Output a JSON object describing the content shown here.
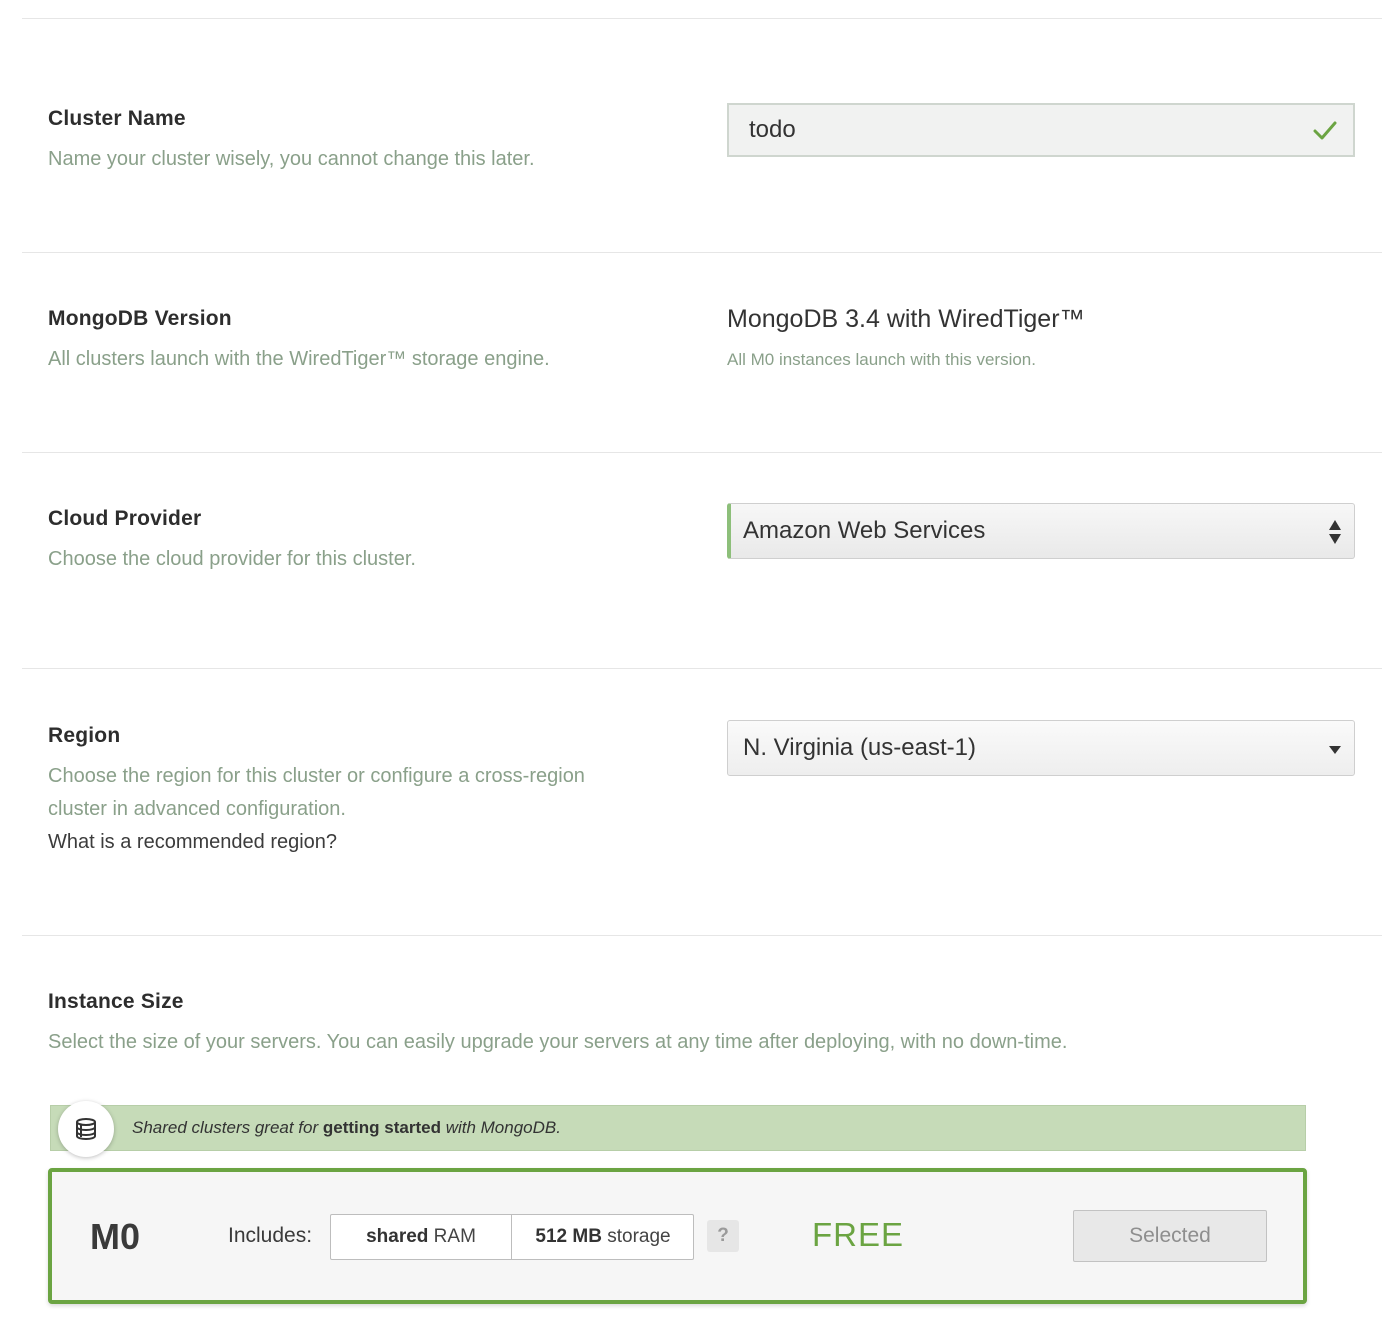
{
  "cluster_name": {
    "label": "Cluster Name",
    "description": "Name your cluster wisely, you cannot change this later.",
    "value": "todo",
    "status_icon": "check-icon",
    "accent_color": "#6ba442"
  },
  "mongodb_version": {
    "label": "MongoDB Version",
    "description": "All clusters launch with the WiredTiger™ storage engine.",
    "value": "MongoDB 3.4 with WiredTiger™",
    "note": "All M0 instances launch with this version."
  },
  "cloud_provider": {
    "label": "Cloud Provider",
    "description": "Choose the cloud provider for this cluster.",
    "selected": "Amazon Web Services",
    "icon": "updown-icon"
  },
  "region": {
    "label": "Region",
    "description_line1": "Choose the region for this cluster or configure a cross-region",
    "description_line2": "cluster in advanced configuration.",
    "help_link": "What is a recommended region?",
    "selected": "N. Virginia (us-east-1)",
    "icon": "caret-down-icon"
  },
  "instance_size": {
    "label": "Instance Size",
    "description": "Select the size of your servers. You can easily upgrade your servers at any time after deploying, with no down-time.",
    "banner": {
      "icon": "database-icon",
      "prefix": "Shared clusters great for",
      "emphasis": "getting started",
      "suffix": "with MongoDB."
    },
    "tier": {
      "name": "M0",
      "includes_label": "Includes:",
      "ram_bold": "shared",
      "ram_unit": "RAM",
      "storage_bold": "512 MB",
      "storage_unit": "storage",
      "help": "?",
      "price": "FREE",
      "button": "Selected",
      "border_color": "#6ba442"
    }
  }
}
